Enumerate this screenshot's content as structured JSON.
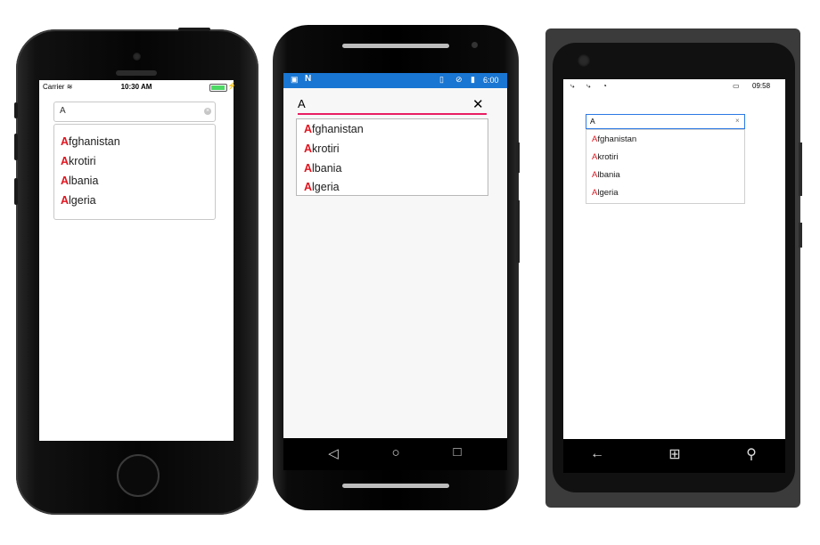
{
  "query": "A",
  "suggestions": [
    {
      "highlight": "A",
      "rest": "fghanistan"
    },
    {
      "highlight": "A",
      "rest": "krotiri"
    },
    {
      "highlight": "A",
      "rest": "lbania"
    },
    {
      "highlight": "A",
      "rest": "lgeria"
    }
  ],
  "ios": {
    "carrier": "Carrier",
    "time": "10:30 AM",
    "clear_glyph": "×"
  },
  "android": {
    "time": "6:00",
    "clear_glyph": "✕",
    "status_color": "#1976d2",
    "underline_color": "#e91e63",
    "nav": {
      "back": "◁",
      "home": "○",
      "recents": "□"
    }
  },
  "windows": {
    "time": "09:58",
    "clear_glyph": "×",
    "border_color": "#2b78e4",
    "nav": {
      "back": "←",
      "start": "⊞",
      "search": "⚲"
    }
  },
  "highlight_color": "#e0141e"
}
